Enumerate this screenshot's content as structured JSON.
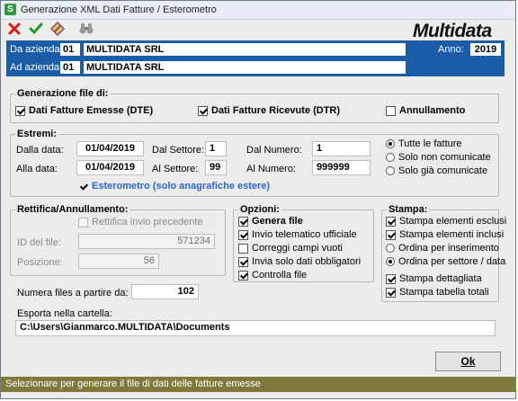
{
  "window": {
    "title": "Generazione XML Dati Fatture / Esterometro"
  },
  "brand": {
    "logo": "Multidata"
  },
  "toolbar": {
    "icons": [
      "close-icon",
      "check-icon",
      "edit-icon",
      "binoculars-icon"
    ]
  },
  "header": {
    "da_label": "Da azienda:",
    "da_code": "01",
    "da_name": "MULTIDATA SRL",
    "ad_label": "Ad azienda:",
    "ad_code": "01",
    "ad_name": "MULTIDATA SRL",
    "anno_label": "Anno:",
    "anno_value": "2019"
  },
  "generazione": {
    "title": "Generazione file di:",
    "emesse": {
      "label": "Dati Fatture Emesse (DTE)",
      "checked": true
    },
    "ricevute": {
      "label": "Dati Fatture Ricevute (DTR)",
      "checked": true
    },
    "annullamento": {
      "label": "Annullamento",
      "checked": false
    }
  },
  "estremi": {
    "title": "Estremi:",
    "dalla_data_label": "Dalla data:",
    "dalla_data": "01/04/2019",
    "alla_data_label": "Alla data:",
    "alla_data": "01/04/2019",
    "dal_settore_label": "Dal Settore:",
    "dal_settore": "1",
    "al_settore_label": "Al Settore:",
    "al_settore": "99",
    "dal_numero_label": "Dal Numero:",
    "dal_numero": "1",
    "al_numero_label": "Al Numero:",
    "al_numero": "999999",
    "radio_tutte": "Tutte le fatture",
    "radio_non_comunicate": "Solo non comunicate",
    "radio_gia_comunicate": "Solo già comunicate",
    "esterometro": "Esterometro (solo anagrafiche estere)"
  },
  "rettifica": {
    "title": "Rettifica/Annullamento:",
    "checkbox": "Rettifica invio precedente",
    "id_label": "ID del file:",
    "id_value": "571234",
    "posizione_label": "Posizione:",
    "posizione_value": "56"
  },
  "opzioni": {
    "title": "Opzioni:",
    "genera_file": "Genera file",
    "invio_telematico": "Invio telematico ufficiale",
    "correggi_campi": "Correggi campi vuoti",
    "invia_solo": "Invia solo dati obbligatori",
    "controlla_file": "Controlla file"
  },
  "stampa": {
    "title": "Stampa:",
    "elementi_esclusi": "Stampa elementi esclusi",
    "elementi_inclusi": "Stampa elementi inclusi",
    "ordina_inserimento": "Ordina per inserimento",
    "ordina_settore": "Ordina per settore / data",
    "dettagliata": "Stampa dettagliata",
    "tabella_totali": "Stampa tabella totali"
  },
  "numera": {
    "label": "Numera files a partire da:",
    "value": "102"
  },
  "esporta": {
    "label": "Esporta nella cartella:",
    "value": "C:\\Users\\Gianmarco.MULTIDATA\\Documents"
  },
  "ok_label": "Ok",
  "status": "Selezionare per generare il file di dati delle fatture emesse"
}
